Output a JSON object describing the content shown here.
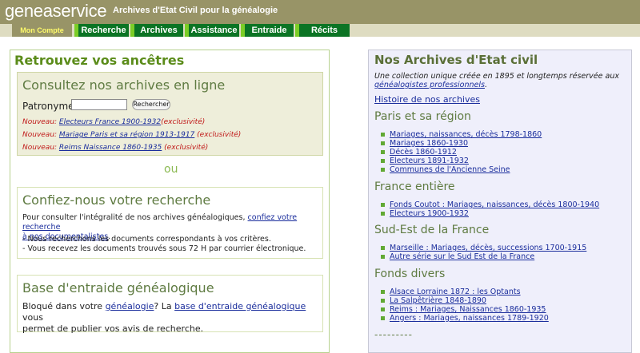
{
  "header": {
    "logo": "geneaservice",
    "tagline": "Archives d'Etat Civil pour la généalogie"
  },
  "nav": {
    "tabs": [
      {
        "label": "Mon Compte",
        "active": true
      },
      {
        "label": "Recherche"
      },
      {
        "label": "Archives"
      },
      {
        "label": "Assistance"
      },
      {
        "label": "Entraide"
      },
      {
        "label": "Récits"
      }
    ]
  },
  "left": {
    "title": "Retrouvez vos ancêtres",
    "online": {
      "title": "Consultez nos archives en ligne",
      "search_label": "Patronyme",
      "search_value": "",
      "search_button": "Rechercher",
      "news": [
        {
          "prefix": "Nouveau: ",
          "link": "Electeurs France 1900-1932",
          "suffix": "(exclusivité)"
        },
        {
          "prefix": "Nouveau: ",
          "link": "Mariage Paris et sa région 1913-1917",
          "suffix": " (exclusivité)"
        },
        {
          "prefix": "Nouveau: ",
          "link": "Reims Naissance 1860-1935",
          "suffix": " (exclusivité)"
        }
      ]
    },
    "or_text": "ou",
    "research": {
      "title": "Confiez-nous votre recherche",
      "text": "Pour consulter l'intégralité de nos archives généalogiques,",
      "link_part1": "confiez votre recherche",
      "link_part2": "à nos documentalistes",
      "text_end": ".",
      "bullet1": "- Nous recherchons les documents correspondants à vos critères.",
      "bullet2": "- Vous recevez les documents trouvés sous 72 H par courrier électronique."
    },
    "mutual": {
      "title": "Base d'entraide généalogique",
      "text1": "Bloqué dans votre ",
      "link1": "généalogie",
      "text2": "? La ",
      "link2": "base d'entraide généalogique",
      "text3": " vous",
      "line2": "permet de publier vos avis de recherche."
    }
  },
  "right": {
    "title": "Nos Archives d'Etat civil",
    "intro_line1": "Une collection unique créée en 1895 et longtemps réservée aux",
    "intro_link": "généalogistes professionnels",
    "intro_end": ".",
    "history_link": "Histoire de nos archives",
    "sections": [
      {
        "title": "Paris et sa région",
        "links": [
          "Mariages, naissances, décès 1798-1860",
          "Mariages 1860-1930",
          "Décès 1860-1912",
          "Electeurs 1891-1932",
          "Communes de l'Ancienne Seine"
        ]
      },
      {
        "title": "France entière",
        "links": [
          "Fonds Coutot : Mariages, naissances, décès 1800-1940",
          "Electeurs 1900-1932"
        ]
      },
      {
        "title": "Sud-Est de la France",
        "links": [
          "Marseille : Mariages, décès, successions 1700-1915",
          "Autre série sur le Sud Est de la France"
        ]
      },
      {
        "title": "Fonds divers",
        "links": [
          "Alsace Lorraine 1872 : les Optants",
          "La Salpêtrière 1848-1890",
          "Reims : Mariages, Naissances 1860-1935",
          "Angers : Mariages, naissances 1789-1920"
        ]
      }
    ],
    "dashes": "---------"
  }
}
